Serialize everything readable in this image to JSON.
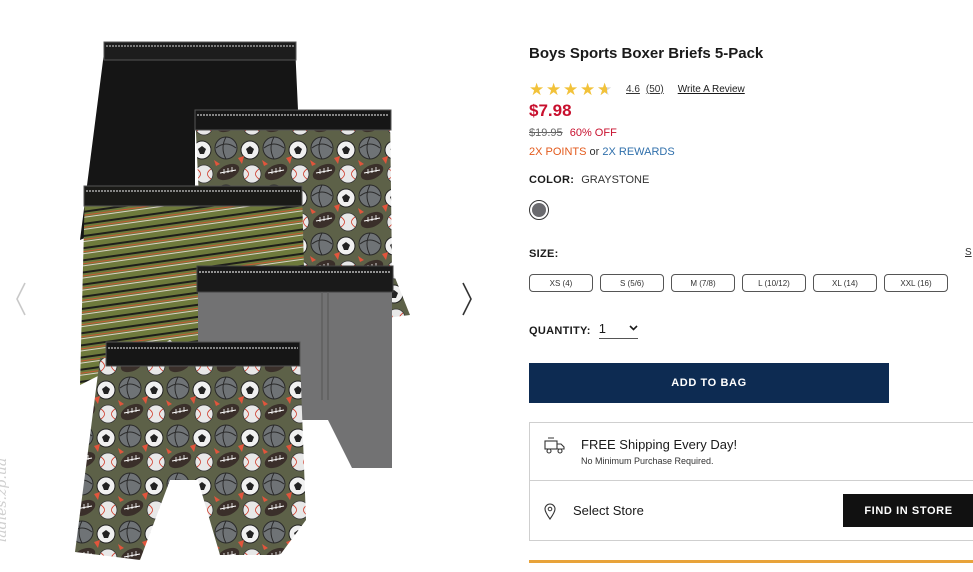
{
  "gallery": {
    "prev_icon": "chevron-left-icon",
    "next_icon": "chevron-right-icon",
    "watermark": "ladies.zp.ua"
  },
  "product": {
    "title": "Boys Sports Boxer Briefs 5-Pack",
    "rating": {
      "stars_filled": 4.6,
      "value": "4.6",
      "count": "(50)",
      "write_review": "Write A Review",
      "star_color": "#f2c23a"
    },
    "price": "$7.98",
    "original_price": "$19.95",
    "discount": "60% OFF",
    "points": "2X POINTS",
    "or_text": "or",
    "rewards": "2X REWARDS",
    "color": {
      "label": "COLOR:",
      "value": "GRAYSTONE",
      "swatch_color": "#6b6b6f"
    },
    "size": {
      "label": "SIZE:",
      "chart_link": "S",
      "options": [
        "XS (4)",
        "S (5/6)",
        "M (7/8)",
        "L (10/12)",
        "XL (14)",
        "XXL (16)"
      ]
    },
    "quantity": {
      "label": "QUANTITY:",
      "value": "1"
    },
    "add_to_bag": "ADD TO BAG"
  },
  "shipping": {
    "title": "FREE Shipping Every Day!",
    "subtitle": "No Minimum Purchase Required.",
    "icon": "truck-icon"
  },
  "store": {
    "label": "Select Store",
    "button": "FIND IN STORE",
    "icon": "map-pin-icon"
  },
  "colors": {
    "price_red": "#c8102e",
    "points_orange": "#e35a1c",
    "rewards_blue": "#2f6fab",
    "add_to_bag_bg": "#0d2b52",
    "find_in_store_bg": "#111111",
    "accent_rule": "#e8a33a"
  }
}
